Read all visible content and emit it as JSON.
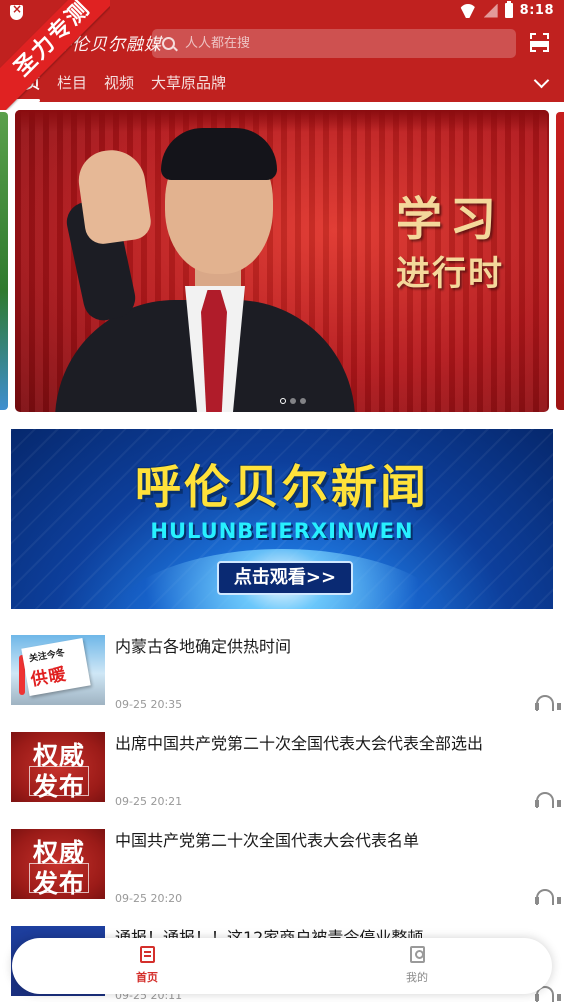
{
  "status_bar": {
    "time": "8:18"
  },
  "ribbon": {
    "text": "圣力专测"
  },
  "header": {
    "logo_text": "呼伦贝尔融媒",
    "search_placeholder": "人人都在搜"
  },
  "tabs": [
    {
      "label": "首页"
    },
    {
      "label": "栏目"
    },
    {
      "label": "视频"
    },
    {
      "label": "大草原品牌"
    }
  ],
  "carousel": {
    "slide_title_line1": "学习",
    "slide_title_line2": "进行时",
    "slide_count": 3,
    "active_index": 0
  },
  "ad_banner": {
    "title": "呼伦贝尔新闻",
    "subtitle": "HULUNBEIERXINWEN",
    "button_label": "点击观看>>"
  },
  "thumbnails": {
    "heating_line1": "关注今冬",
    "heating_line2": "供暖",
    "authority_line1": "权威",
    "authority_line2": "发布"
  },
  "news": [
    {
      "title": "内蒙古各地确定供热时间",
      "time": "09-25 20:35"
    },
    {
      "title": "出席中国共产党第二十次全国代表大会代表全部选出",
      "time": "09-25 20:21"
    },
    {
      "title": "中国共产党第二十次全国代表大会代表名单",
      "time": "09-25 20:20"
    },
    {
      "title": "通报！通报！！这12家商户被责令停业整顿",
      "time": "09-25 20:11"
    }
  ],
  "bottom_nav": [
    {
      "label": "首页",
      "icon": "home-news-icon"
    },
    {
      "label": "我的",
      "icon": "profile-icon"
    }
  ],
  "colors": {
    "brand_red": "#c0211f",
    "active_nav_red": "#d4302c",
    "ad_yellow": "#ffe23a"
  }
}
